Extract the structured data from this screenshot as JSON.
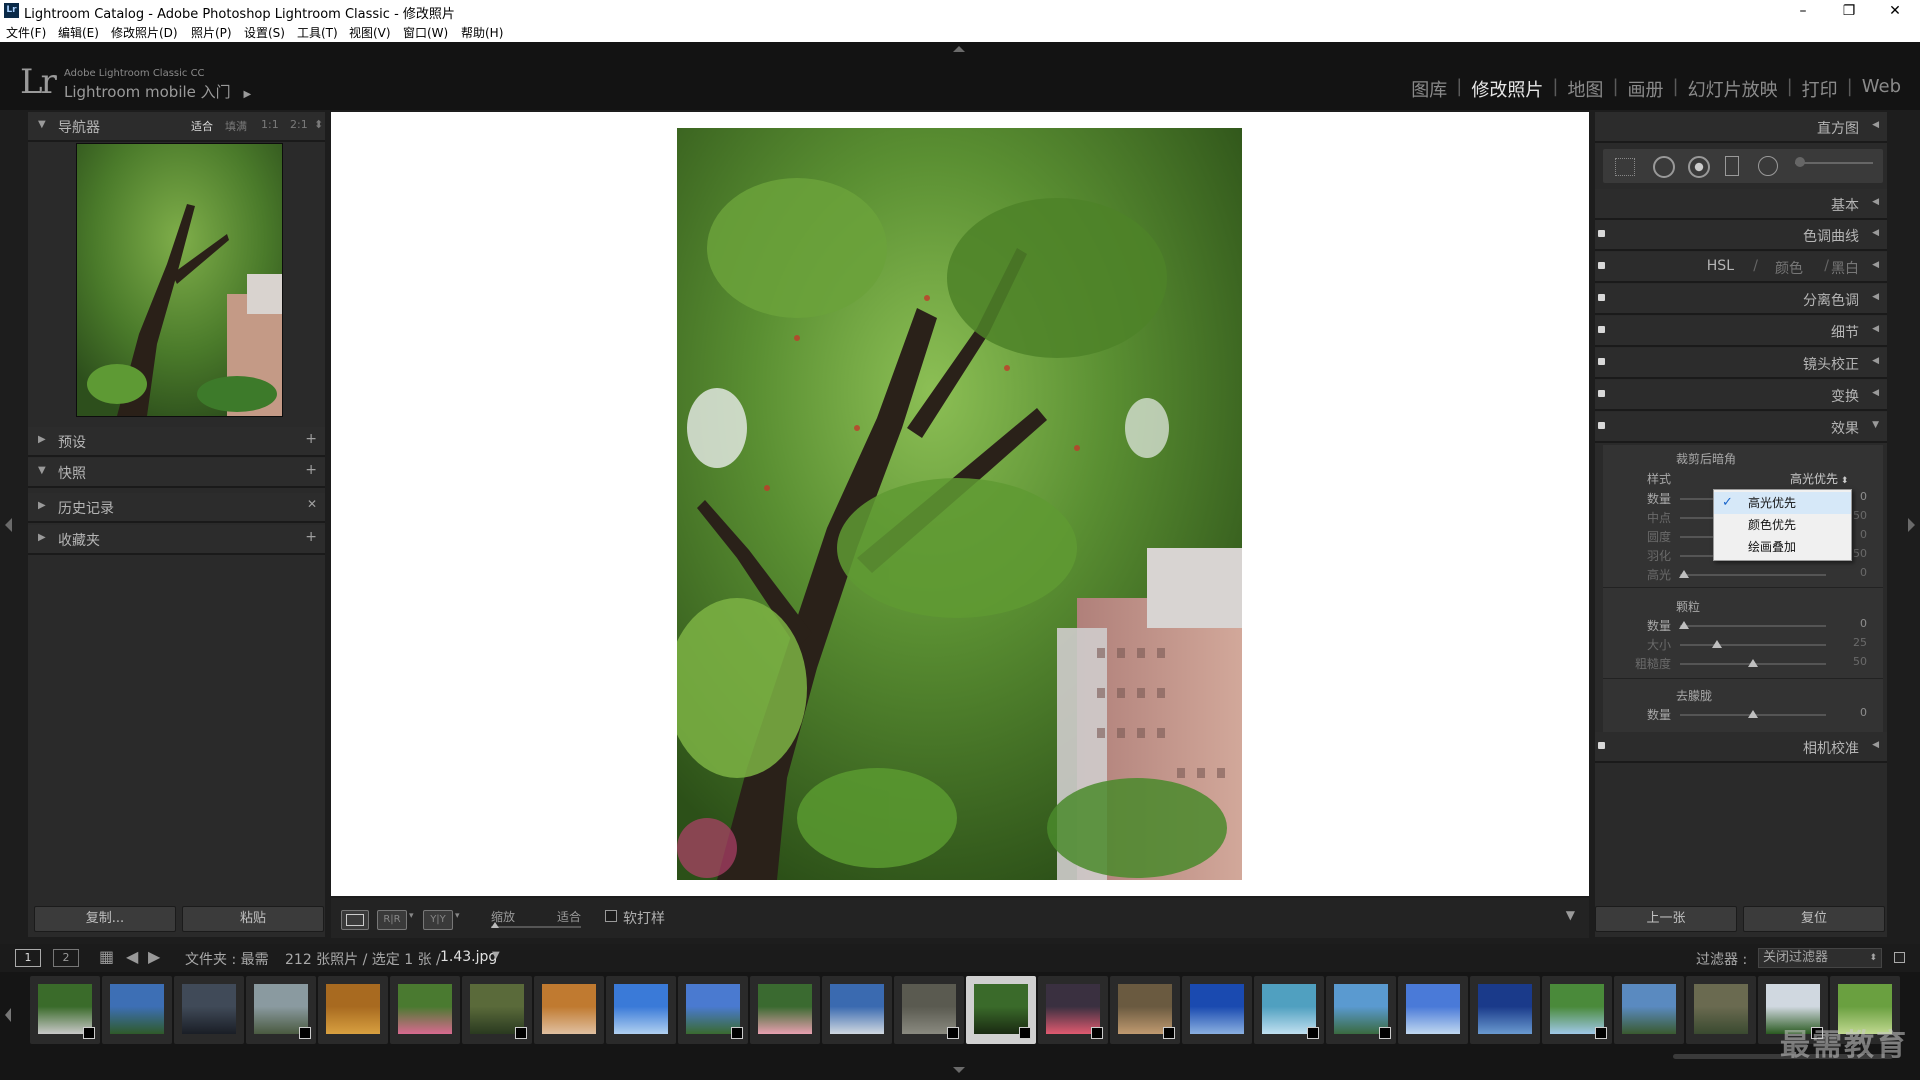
{
  "window": {
    "title": "Lightroom Catalog - Adobe Photoshop Lightroom Classic - 修改照片",
    "app_icon": "Lr",
    "controls": {
      "minimize": "–",
      "restore": "❐",
      "close": "✕"
    }
  },
  "menu": [
    "文件(F)",
    "编辑(E)",
    "修改照片(D)",
    "照片(P)",
    "设置(S)",
    "工具(T)",
    "视图(V)",
    "窗口(W)",
    "帮助(H)"
  ],
  "identity": {
    "logo": "Lr",
    "line1": "Adobe Lightroom Classic CC",
    "line2": "Lightroom mobile 入门",
    "arrow": "▶"
  },
  "modules": [
    "图库",
    "修改照片",
    "地图",
    "画册",
    "幻灯片放映",
    "打印",
    "Web"
  ],
  "active_module": "修改照片",
  "left_panel": {
    "navigator": {
      "title": "导航器",
      "zoom": [
        "适合",
        "填满",
        "1:1",
        "2:1"
      ],
      "zoom_active": "适合"
    },
    "sections": [
      {
        "label": "预设",
        "action": "+"
      },
      {
        "label": "快照",
        "action": "+"
      },
      {
        "label": "历史记录",
        "action": "✕"
      },
      {
        "label": "收藏夹",
        "action": "+"
      }
    ],
    "copy_button": "复制...",
    "paste_button": "粘贴"
  },
  "toolbar": {
    "view_labels": [
      "R|R",
      "Y|Y"
    ],
    "zoom_label": "缩放",
    "zoom_value": "适合",
    "softproof": "软打样"
  },
  "right_panel": {
    "histogram": "直方图",
    "sections": [
      {
        "label": "基本"
      },
      {
        "label": "色调曲线"
      },
      {
        "label": "HSL",
        "extra1": "颜色",
        "extra2": "黑白"
      },
      {
        "label": "分离色调"
      },
      {
        "label": "细节"
      },
      {
        "label": "镜头校正"
      },
      {
        "label": "变换"
      },
      {
        "label": "效果"
      }
    ],
    "vignette": {
      "title": "裁剪后暗角",
      "style_label": "样式",
      "style_value": "高光优先",
      "rows": [
        {
          "label": "数量",
          "value": "0",
          "pos": 0.5
        },
        {
          "label": "中点",
          "value": "50",
          "pos": 0.5
        },
        {
          "label": "圆度",
          "value": "0",
          "pos": 0.5
        },
        {
          "label": "羽化",
          "value": "50",
          "pos": 0.5
        },
        {
          "label": "高光",
          "value": "0",
          "pos": 0.03
        }
      ]
    },
    "grain": {
      "title": "颗粒",
      "rows": [
        {
          "label": "数量",
          "value": "0",
          "pos": 0.03
        },
        {
          "label": "大小",
          "value": "25",
          "pos": 0.25
        },
        {
          "label": "粗糙度",
          "value": "50",
          "pos": 0.5
        }
      ]
    },
    "dehaze": {
      "title": "去朦胧",
      "rows": [
        {
          "label": "数量",
          "value": "0",
          "pos": 0.5
        }
      ]
    },
    "camera_calibration": "相机校准",
    "prev_button": "上一张",
    "reset_button": "复位"
  },
  "dropdown": {
    "options": [
      "高光优先",
      "颜色优先",
      "绘画叠加"
    ],
    "selected": "高光优先"
  },
  "filmstrip_bar": {
    "screen1": "1",
    "screen2": "2",
    "source_prefix": "文件夹 : 最需",
    "count": "212 张照片 / 选定 1 张 /",
    "filename": "1.43.jpg",
    "filter_label": "过滤器 :",
    "filter_value": "关闭过滤器"
  },
  "filmstrip": {
    "thumbs": [
      {
        "c1": "#3a6b2a",
        "c2": "#c8c8c8"
      },
      {
        "c1": "#3d6fb5",
        "c2": "#2f5a2a"
      },
      {
        "c1": "#404a58",
        "c2": "#1a1e26"
      },
      {
        "c1": "#8a9aa0",
        "c2": "#4a5a40"
      },
      {
        "c1": "#a86a20",
        "c2": "#d8a040"
      },
      {
        "c1": "#4a7a30",
        "c2": "#d86a90"
      },
      {
        "c1": "#5a6a3a",
        "c2": "#2a3a20"
      },
      {
        "c1": "#c07a30",
        "c2": "#e0c0a0"
      },
      {
        "c1": "#3a7ad8",
        "c2": "#b0d0f0"
      },
      {
        "c1": "#4a7ad0",
        "c2": "#3a6a30"
      },
      {
        "c1": "#3a6a30",
        "c2": "#e8a0b0"
      },
      {
        "c1": "#3a6ab0",
        "c2": "#d0d8e0"
      },
      {
        "c1": "#5a5a50",
        "c2": "#8a8a80"
      },
      {
        "c1": "#3a6a2a",
        "c2": "#1a2a12"
      },
      {
        "c1": "#3a3040",
        "c2": "#e05a70"
      },
      {
        "c1": "#6a5a40",
        "c2": "#c09a70"
      },
      {
        "c1": "#1a4ab0",
        "c2": "#8ab0e0"
      },
      {
        "c1": "#50a0c0",
        "c2": "#c0e0f0"
      },
      {
        "c1": "#5a9ad0",
        "c2": "#3a6a40"
      },
      {
        "c1": "#4a7ad8",
        "c2": "#c0d8f0"
      },
      {
        "c1": "#1a3a8a",
        "c2": "#6a9ad0"
      },
      {
        "c1": "#4a8a3a",
        "c2": "#a0c8e8"
      },
      {
        "c1": "#5a8ac0",
        "c2": "#3a5a30"
      },
      {
        "c1": "#6a6a50",
        "c2": "#3a4a30"
      },
      {
        "c1": "#d0d8e0",
        "c2": "#2a5a20"
      },
      {
        "c1": "#6aa040",
        "c2": "#c0d890"
      }
    ],
    "selected_index": 13
  },
  "watermark": "最需教育",
  "colors": {
    "accent": "#d8d8d8",
    "workspace": "#ffffff",
    "panel": "#2a2a2a"
  }
}
